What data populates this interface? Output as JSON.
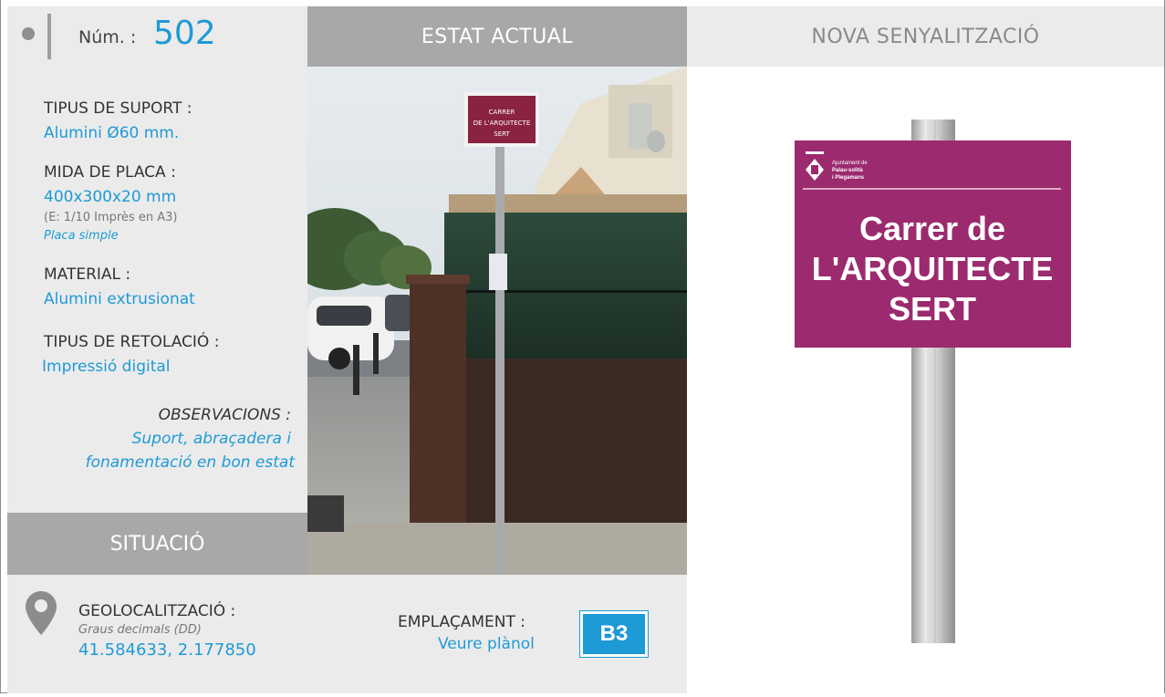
{
  "header": {
    "num_label": "Núm. :",
    "num_value": "502",
    "estat_actual": "ESTAT ACTUAL",
    "nova_senyalitzacio": "NOVA SENYALITZACIÓ"
  },
  "info": {
    "tipus_suport_label": "TIPUS DE SUPORT :",
    "tipus_suport_value": "Alumini Ø60 mm.",
    "mida_label": "MIDA DE PLACA :",
    "mida_value": "400x300x20 mm",
    "mida_note": "(E: 1/10 Imprès en A3)",
    "mida_type": "Placa simple",
    "material_label": "MATERIAL :",
    "material_value": "Alumini extrusionat",
    "retolacio_label": "TIPUS DE RETOLACIÓ :",
    "retolacio_value": "Impressió digital",
    "observacions_label": "OBSERVACIONS :",
    "observacions_line1": "Suport, abraçadera i",
    "observacions_line2": "fonamentació en bon estat"
  },
  "situacio": {
    "title": "SITUACIÓ",
    "geo_label": "GEOLOCALITZACIÓ :",
    "geo_format": "Graus decimals (DD)",
    "geo_coords": "41.584633, 2.177850",
    "emplacament_label": "EMPLAÇAMENT :",
    "emplacament_link": "Veure plànol",
    "zone_code": "B3"
  },
  "photo": {
    "sign_line1": "CARRER",
    "sign_line2": "DE L'ARQUITECTE",
    "sign_line3": "SERT"
  },
  "new_sign": {
    "org_line1": "Ajuntament de",
    "org_line2": "Palau-solità",
    "org_line3": "i Plegamans",
    "street_line1": "Carrer de",
    "street_line2": "L'ARQUITECTE",
    "street_line3": "SERT"
  },
  "colors": {
    "accent_blue": "#1e9ad6",
    "sign_magenta": "#9b2a6e",
    "header_gray": "#a8a8a8",
    "panel_gray": "#ebebeb"
  }
}
